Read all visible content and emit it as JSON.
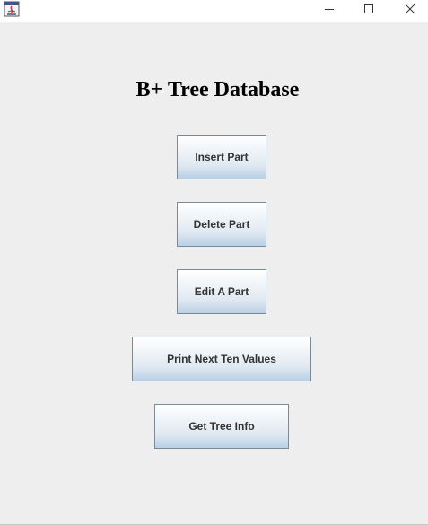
{
  "window": {
    "icons": {
      "app": "java-app-icon",
      "minimize": "minimize-icon",
      "maximize": "maximize-icon",
      "close": "close-icon"
    }
  },
  "main": {
    "heading": "B+ Tree Database",
    "buttons": [
      {
        "label": "Insert Part"
      },
      {
        "label": "Delete Part"
      },
      {
        "label": "Edit A Part"
      },
      {
        "label": "Print Next Ten Values"
      },
      {
        "label": "Get Tree Info"
      }
    ]
  },
  "colors": {
    "background": "#eeeeee",
    "titlebar": "#ffffff",
    "button_border": "#7a8a99",
    "button_gradient_bottom": "#b8cfe5",
    "button_text": "#333333"
  }
}
